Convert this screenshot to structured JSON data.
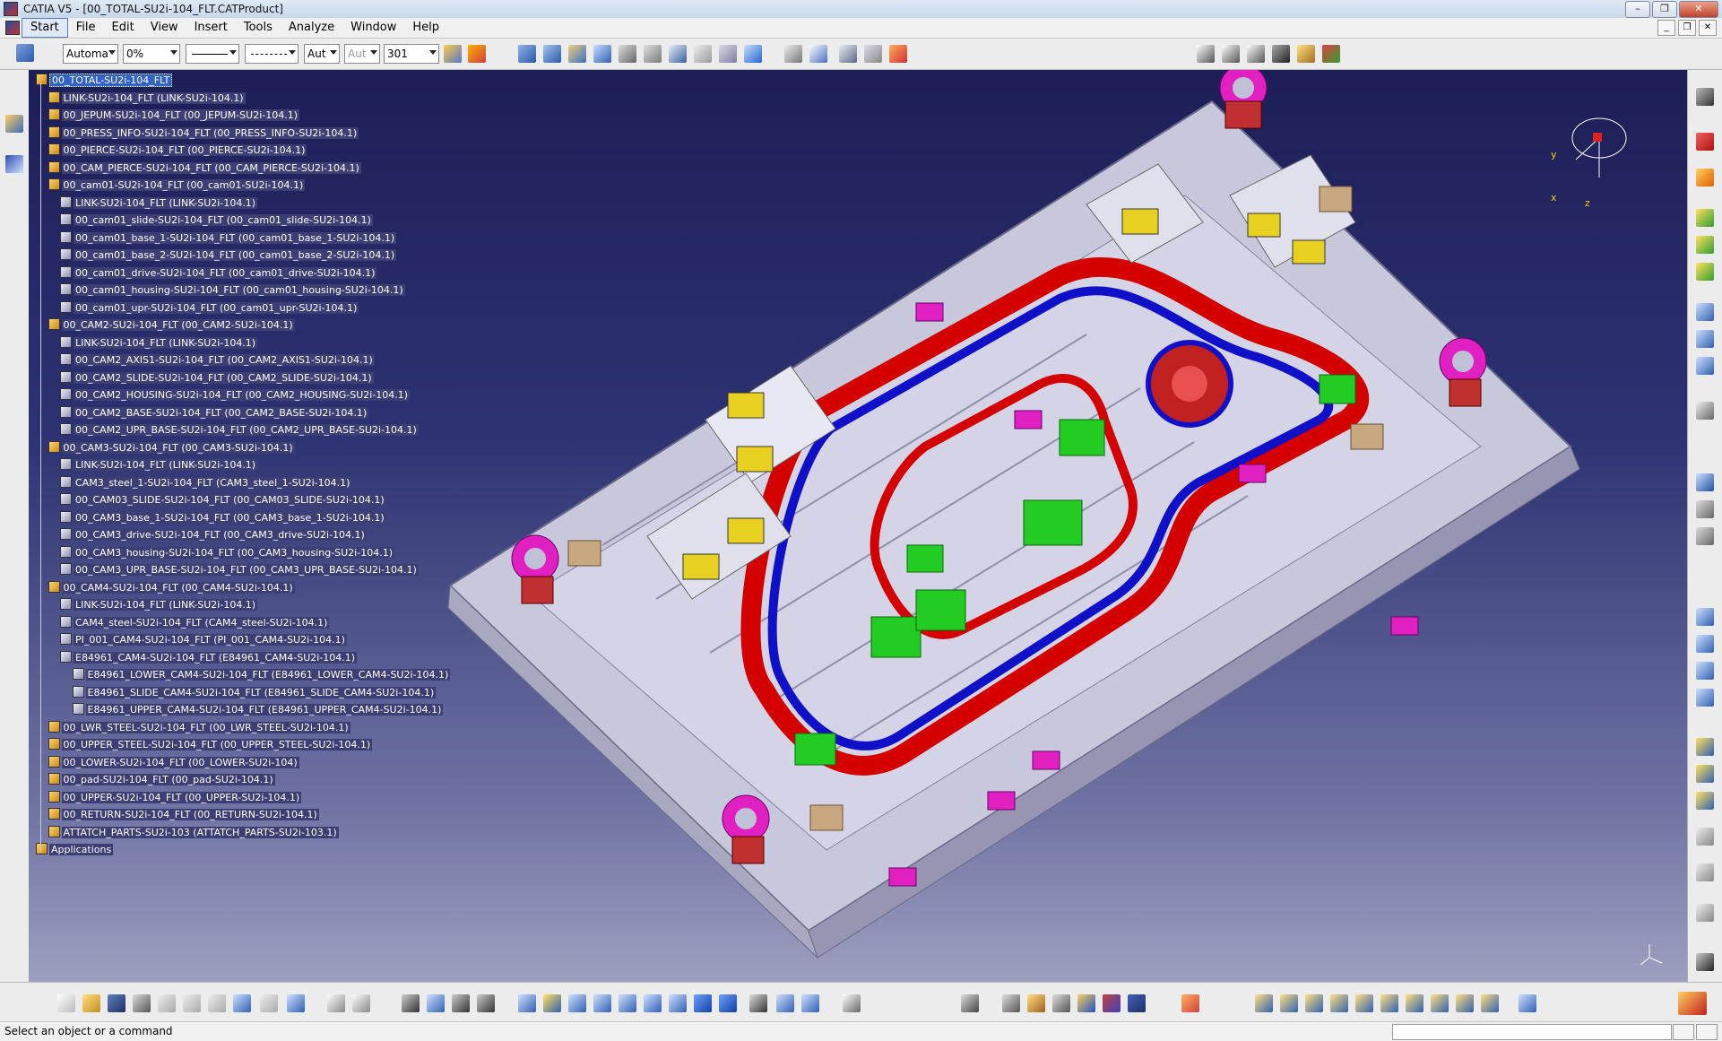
{
  "window": {
    "title": "CATIA V5 - [00_TOTAL-SU2i-104_FLT.CATProduct]"
  },
  "menu": {
    "items": [
      "Start",
      "File",
      "Edit",
      "View",
      "Insert",
      "Tools",
      "Analyze",
      "Window",
      "Help"
    ]
  },
  "toolbar": {
    "color_combo": "Automa",
    "transparency_combo": "0%",
    "linetype_combo": "",
    "linestyle_combo": "",
    "thickness_combo": "Aut",
    "layer_combo_disabled": "Aut",
    "layer_value": "301"
  },
  "tree": {
    "nodes": [
      {
        "label": "00_TOTAL-SU2i-104_FLT",
        "level": 0,
        "selected": true
      },
      {
        "label": "LINK-SU2i-104_FLT (LINK-SU2i-104.1)",
        "level": 1
      },
      {
        "label": "00_JEPUM-SU2i-104_FLT (00_JEPUM-SU2i-104.1)",
        "level": 1
      },
      {
        "label": "00_PRESS_INFO-SU2i-104_FLT (00_PRESS_INFO-SU2i-104.1)",
        "level": 1
      },
      {
        "label": "00_PIERCE-SU2i-104_FLT (00_PIERCE-SU2i-104.1)",
        "level": 1
      },
      {
        "label": "00_CAM_PIERCE-SU2i-104_FLT (00_CAM_PIERCE-SU2i-104.1)",
        "level": 1
      },
      {
        "label": "00_cam01-SU2i-104_FLT (00_cam01-SU2i-104.1)",
        "level": 1
      },
      {
        "label": "LINK-SU2i-104_FLT (LINK-SU2i-104.1)",
        "level": 2
      },
      {
        "label": "00_cam01_slide-SU2i-104_FLT (00_cam01_slide-SU2i-104.1)",
        "level": 2
      },
      {
        "label": "00_cam01_base_1-SU2i-104_FLT (00_cam01_base_1-SU2i-104.1)",
        "level": 2
      },
      {
        "label": "00_cam01_base_2-SU2i-104_FLT (00_cam01_base_2-SU2i-104.1)",
        "level": 2
      },
      {
        "label": "00_cam01_drive-SU2i-104_FLT (00_cam01_drive-SU2i-104.1)",
        "level": 2
      },
      {
        "label": "00_cam01_housing-SU2i-104_FLT (00_cam01_housing-SU2i-104.1)",
        "level": 2
      },
      {
        "label": "00_cam01_upr-SU2i-104_FLT (00_cam01_upr-SU2i-104.1)",
        "level": 2
      },
      {
        "label": "00_CAM2-SU2i-104_FLT (00_CAM2-SU2i-104.1)",
        "level": 1
      },
      {
        "label": "LINK-SU2i-104_FLT (LINK-SU2i-104.1)",
        "level": 2
      },
      {
        "label": "00_CAM2_AXIS1-SU2i-104_FLT (00_CAM2_AXIS1-SU2i-104.1)",
        "level": 2
      },
      {
        "label": "00_CAM2_SLIDE-SU2i-104_FLT (00_CAM2_SLIDE-SU2i-104.1)",
        "level": 2
      },
      {
        "label": "00_CAM2_HOUSING-SU2i-104_FLT (00_CAM2_HOUSING-SU2i-104.1)",
        "level": 2
      },
      {
        "label": "00_CAM2_BASE-SU2i-104_FLT (00_CAM2_BASE-SU2i-104.1)",
        "level": 2
      },
      {
        "label": "00_CAM2_UPR_BASE-SU2i-104_FLT (00_CAM2_UPR_BASE-SU2i-104.1)",
        "level": 2
      },
      {
        "label": "00_CAM3-SU2i-104_FLT (00_CAM3-SU2i-104.1)",
        "level": 1
      },
      {
        "label": "LINK-SU2i-104_FLT (LINK-SU2i-104.1)",
        "level": 2
      },
      {
        "label": "CAM3_steel_1-SU2i-104_FLT (CAM3_steel_1-SU2i-104.1)",
        "level": 2
      },
      {
        "label": "00_CAM03_SLIDE-SU2i-104_FLT (00_CAM03_SLIDE-SU2i-104.1)",
        "level": 2
      },
      {
        "label": "00_CAM3_base_1-SU2i-104_FLT (00_CAM3_base_1-SU2i-104.1)",
        "level": 2
      },
      {
        "label": "00_CAM3_drive-SU2i-104_FLT (00_CAM3_drive-SU2i-104.1)",
        "level": 2
      },
      {
        "label": "00_CAM3_housing-SU2i-104_FLT (00_CAM3_housing-SU2i-104.1)",
        "level": 2
      },
      {
        "label": "00_CAM3_UPR_BASE-SU2i-104_FLT (00_CAM3_UPR_BASE-SU2i-104.1)",
        "level": 2
      },
      {
        "label": "00_CAM4-SU2i-104_FLT (00_CAM4-SU2i-104.1)",
        "level": 1
      },
      {
        "label": "LINK-SU2i-104_FLT (LINK-SU2i-104.1)",
        "level": 2
      },
      {
        "label": "CAM4_steel-SU2i-104_FLT (CAM4_steel-SU2i-104.1)",
        "level": 2
      },
      {
        "label": "PI_001_CAM4-SU2i-104_FLT (PI_001_CAM4-SU2i-104.1)",
        "level": 2
      },
      {
        "label": "E84961_CAM4-SU2i-104_FLT (E84961_CAM4-SU2i-104.1)",
        "level": 2
      },
      {
        "label": "E84961_LOWER_CAM4-SU2i-104_FLT (E84961_LOWER_CAM4-SU2i-104.1)",
        "level": 3
      },
      {
        "label": "E84961_SLIDE_CAM4-SU2i-104_FLT (E84961_SLIDE_CAM4-SU2i-104.1)",
        "level": 3
      },
      {
        "label": "E84961_UPPER_CAM4-SU2i-104_FLT (E84961_UPPER_CAM4-SU2i-104.1)",
        "level": 3
      },
      {
        "label": "00_LWR_STEEL-SU2i-104_FLT (00_LWR_STEEL-SU2i-104.1)",
        "level": 1
      },
      {
        "label": "00_UPPER_STEEL-SU2i-104_FLT (00_UPPER_STEEL-SU2i-104.1)",
        "level": 1
      },
      {
        "label": "00_LOWER-SU2i-104_FLT (00_LOWER-SU2i-104)",
        "level": 1
      },
      {
        "label": "00_pad-SU2i-104_FLT (00_pad-SU2i-104.1)",
        "level": 1
      },
      {
        "label": "00_UPPER-SU2i-104_FLT (00_UPPER-SU2i-104.1)",
        "level": 1
      },
      {
        "label": "00_RETURN-SU2i-104_FLT (00_RETURN-SU2i-104.1)",
        "level": 1
      },
      {
        "label": "ATTATCH_PARTS-SU2i-103 (ATTATCH_PARTS-SU2i-103.1)",
        "level": 1
      },
      {
        "label": "Applications",
        "level": 0
      }
    ]
  },
  "compass": {
    "x": "x",
    "y": "y",
    "z": "z"
  },
  "status": {
    "message": "Select an object or a command",
    "command_input": ""
  },
  "colors": {
    "viewport_top": "#1d1e57",
    "viewport_bottom": "#9d9fbf",
    "selection": "#3162c6",
    "die_base": "#c8c8dc",
    "profile_red": "#d40000",
    "profile_blue": "#1010c8",
    "pad_green": "#22cc22",
    "pin_magenta": "#e020c0",
    "block_yellow": "#e8d020"
  }
}
